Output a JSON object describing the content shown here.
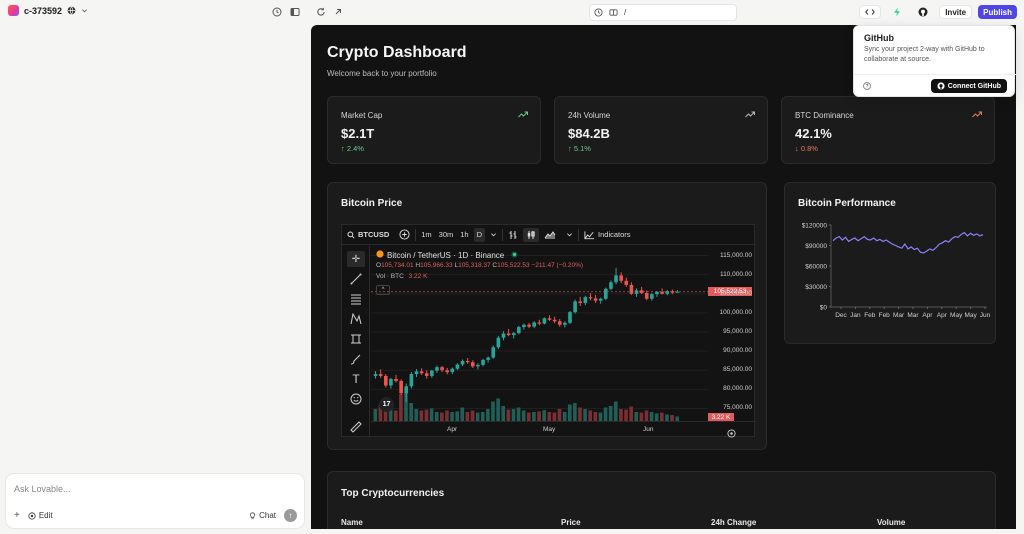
{
  "project": {
    "name": "c-373592"
  },
  "url": {
    "path": "/"
  },
  "actions": {
    "invite": "Invite",
    "publish": "Publish"
  },
  "chat": {
    "placeholder": "Ask Lovable...",
    "edit": "Edit",
    "chat": "Chat"
  },
  "dashboard": {
    "title": "Crypto Dashboard",
    "subtitle": "Welcome back to your portfolio",
    "stats": [
      {
        "label": "Market Cap",
        "value": "$2.1T",
        "change": "↑ 2.4%",
        "color": "#6cc98a"
      },
      {
        "label": "24h Volume",
        "value": "$84.2B",
        "change": "↑ 5.1%",
        "color": "#6cc98a"
      },
      {
        "label": "BTC Dominance",
        "value": "42.1%",
        "change": "↓ 0.8%",
        "color": "#e27a5a"
      }
    ],
    "bitcoin_price_title": "Bitcoin Price",
    "bitcoin_performance_title": "Bitcoin Performance",
    "top_title": "Top Cryptocurrencies",
    "table_headers": [
      "Name",
      "Price",
      "24h Change",
      "Volume"
    ]
  },
  "tradingview": {
    "symbol": "BTCUSD",
    "intervals": [
      "1m",
      "30m",
      "1h",
      "D"
    ],
    "indicators": "Indicators",
    "legend": "Bitcoin / TetherUS · 1D · Binance",
    "ohlc": {
      "o": "105,734.01",
      "h": "105,966.33",
      "l": "105,318.37",
      "c": "105,522.53",
      "chg": "−211.47 (−0.20%)"
    },
    "vol_label": "Vol · BTC",
    "vol_value": "3.22 K",
    "current_price": "105,522.53",
    "current_vol": "3.22 K",
    "price_ticks": [
      "115,000.00",
      "110,000.00",
      "105,000.00",
      "100,000.00",
      "95,000.00",
      "90,000.00",
      "85,000.00",
      "80,000.00",
      "75,000.00"
    ],
    "time_ticks": [
      "Apr",
      "May",
      "Jun"
    ],
    "candles": [
      [
        83500,
        84800,
        82800,
        84000
      ],
      [
        84000,
        85200,
        83000,
        83500
      ],
      [
        83500,
        84000,
        80500,
        81000
      ],
      [
        81000,
        83000,
        80200,
        82700
      ],
      [
        82700,
        83800,
        81800,
        82200
      ],
      [
        82200,
        82600,
        78500,
        79000
      ],
      [
        79000,
        81500,
        76800,
        80800
      ],
      [
        80800,
        84500,
        80200,
        84000
      ],
      [
        84000,
        85300,
        83200,
        84700
      ],
      [
        84700,
        85500,
        83800,
        84200
      ],
      [
        84200,
        85000,
        82800,
        83500
      ],
      [
        83500,
        85100,
        83000,
        84900
      ],
      [
        84900,
        86200,
        84300,
        85800
      ],
      [
        85800,
        86100,
        84500,
        85000
      ],
      [
        85000,
        85600,
        83900,
        84500
      ],
      [
        84500,
        85700,
        84000,
        85400
      ],
      [
        85400,
        86800,
        85000,
        86500
      ],
      [
        86500,
        87800,
        86100,
        87400
      ],
      [
        87400,
        88200,
        86700,
        87100
      ],
      [
        87100,
        87600,
        85600,
        86000
      ],
      [
        86000,
        86800,
        85200,
        86400
      ],
      [
        86400,
        88000,
        86000,
        87700
      ],
      [
        87700,
        88600,
        87000,
        88300
      ],
      [
        88300,
        91500,
        88000,
        91000
      ],
      [
        91000,
        94000,
        90500,
        93500
      ],
      [
        93500,
        95200,
        92800,
        94600
      ],
      [
        94600,
        95800,
        93900,
        94200
      ],
      [
        94200,
        95000,
        93300,
        94700
      ],
      [
        94700,
        96600,
        94400,
        96300
      ],
      [
        96300,
        97200,
        95600,
        96900
      ],
      [
        96900,
        97400,
        96000,
        96400
      ],
      [
        96400,
        97800,
        96000,
        97500
      ],
      [
        97500,
        98200,
        96800,
        97200
      ],
      [
        97200,
        98800,
        97000,
        98600
      ],
      [
        98600,
        99400,
        97900,
        98200
      ],
      [
        98200,
        99000,
        97300,
        97800
      ],
      [
        97800,
        98400,
        96400,
        96900
      ],
      [
        96900,
        97800,
        96200,
        97400
      ],
      [
        97400,
        100500,
        97100,
        100200
      ],
      [
        100200,
        103500,
        99800,
        103000
      ],
      [
        103000,
        104200,
        101800,
        102600
      ],
      [
        102600,
        104500,
        102000,
        104100
      ],
      [
        104100,
        105200,
        103300,
        103800
      ],
      [
        103800,
        104700,
        102600,
        103200
      ],
      [
        103200,
        104000,
        102400,
        103700
      ],
      [
        103700,
        106600,
        103300,
        106300
      ],
      [
        106300,
        108500,
        105900,
        108000
      ],
      [
        108000,
        111800,
        107500,
        109800
      ],
      [
        109800,
        110600,
        107800,
        108400
      ],
      [
        108400,
        109200,
        106800,
        107300
      ],
      [
        107300,
        108000,
        104700,
        105000
      ],
      [
        105000,
        106400,
        104200,
        105900
      ],
      [
        105900,
        106800,
        104900,
        105200
      ],
      [
        105200,
        105900,
        103300,
        103700
      ],
      [
        103700,
        105200,
        103200,
        104900
      ],
      [
        104900,
        105700,
        104200,
        105500
      ],
      [
        105500,
        106400,
        104800,
        105000
      ],
      [
        105000,
        106000,
        104600,
        105700
      ],
      [
        105700,
        106100,
        104900,
        105300
      ],
      [
        105300,
        105966,
        105318,
        105522
      ]
    ],
    "volumes": [
      40,
      55,
      70,
      45,
      35,
      90,
      95,
      60,
      40,
      35,
      38,
      42,
      30,
      28,
      35,
      30,
      32,
      45,
      30,
      35,
      28,
      30,
      40,
      65,
      75,
      50,
      38,
      40,
      45,
      35,
      28,
      30,
      32,
      36,
      30,
      28,
      40,
      30,
      55,
      60,
      45,
      40,
      35,
      30,
      28,
      45,
      50,
      65,
      40,
      38,
      48,
      30,
      28,
      35,
      30,
      25,
      28,
      22,
      20,
      15
    ]
  },
  "performance": {
    "y_ticks": [
      "$120000",
      "$90000",
      "$60000",
      "$30000",
      "$0"
    ],
    "x_ticks": [
      "Dec",
      "Jan",
      "Feb",
      "Feb",
      "Mar",
      "Mar",
      "Apr",
      "Apr",
      "May",
      "May",
      "Jun"
    ],
    "y_max": 120000,
    "values": [
      97000,
      101000,
      103000,
      98000,
      102000,
      96000,
      99000,
      101000,
      97000,
      100000,
      103000,
      99000,
      98000,
      101000,
      97000,
      99000,
      96000,
      98000,
      95000,
      92000,
      90000,
      88000,
      86000,
      92000,
      85000,
      88000,
      84000,
      86000,
      80000,
      79000,
      82000,
      85000,
      83000,
      87000,
      92000,
      94000,
      97000,
      95000,
      100000,
      103000,
      102000,
      106000,
      109000,
      104000,
      108000,
      105000,
      107000,
      104000,
      106000
    ],
    "line_color": "#8b80f9"
  },
  "github_popover": {
    "title": "GitHub",
    "description": "Sync your project 2-way with GitHub to collaborate at source.",
    "button": "Connect GitHub"
  }
}
